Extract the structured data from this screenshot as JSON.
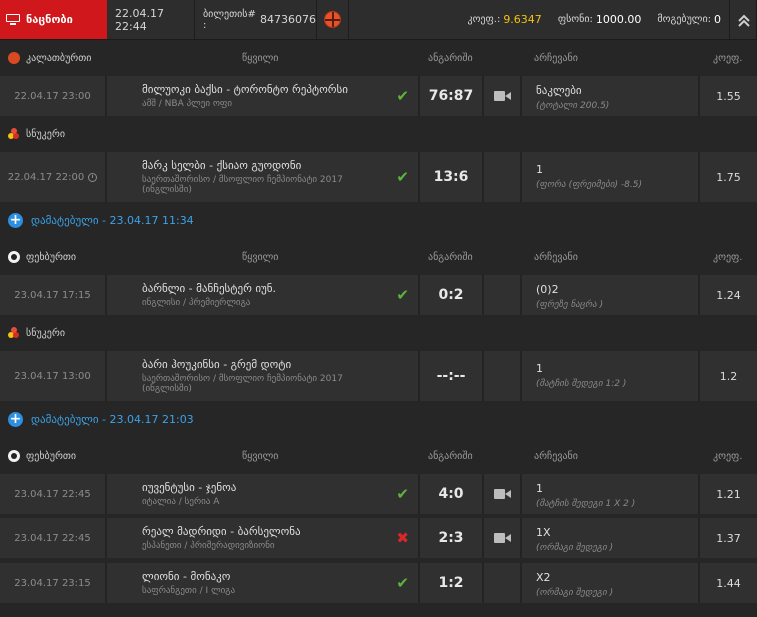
{
  "topbar": {
    "tab_label": "ნაცნობი",
    "datetime": "22.04.17 22:44",
    "ticket_label": "ბილეთის# :",
    "ticket_number": "84736076",
    "coef_label": "კოეფ.:",
    "coef_value": "9.6347",
    "amount_label": "ფსონი:",
    "amount_value": "1000.00",
    "win_label": "მოგებული:",
    "win_value": "0"
  },
  "columns": {
    "event": "წყვილი",
    "score": "ანგარიში",
    "choice": "არჩევანი",
    "coef": "კოეფ."
  },
  "sections": [
    {
      "sport": "კალათბურთი",
      "icon": "basketball-icon"
    },
    {
      "sport": "სნუკერი",
      "icon": "snooker-icon"
    },
    {
      "sport": "ფეხბურთი",
      "icon": "soccer-icon"
    },
    {
      "sport": "სნუკერი",
      "icon": "snooker-icon"
    },
    {
      "sport": "ფეხბურთი",
      "icon": "soccer-icon"
    }
  ],
  "added": [
    {
      "label": "დამატებული - 23.04.17 11:34"
    },
    {
      "label": "დამატებული - 23.04.17 21:03"
    }
  ],
  "rows": [
    {
      "date": "22.04.17 23:00",
      "name": "მილუოკი ბაქსი - ტორონტო რეპტორსი",
      "league": "ამშ / NBA პლეი ოფი",
      "result": "win",
      "score": "76:87",
      "video": true,
      "pick": "ნაკლები",
      "pick_sub": "(ტოტალი 200.5)",
      "coef": "1.55"
    },
    {
      "date": "22.04.17 22:00",
      "name": "მარკ სელბი - ქსიაო გუოდონი",
      "league": "საერთაშორისო / მსოფლიო ჩემპიონატი 2017 (ინგლისში)",
      "result": "win",
      "score": "13:6",
      "video": false,
      "pick": "1",
      "pick_sub": "(ფორა (ფრეიმები) -8.5)",
      "coef": "1.75"
    },
    {
      "date": "23.04.17 17:15",
      "name": "ბარნლი - მანჩესტერ იუნ.",
      "league": "ინგლისი / პრემიერლიგა",
      "result": "win",
      "score": "0:2",
      "video": false,
      "pick": "(0)2",
      "pick_sub": "(ფრეზე ნაცრა )",
      "coef": "1.24"
    },
    {
      "date": "23.04.17 13:00",
      "name": "ბარი ჰოუკინსი - გრემ დოტი",
      "league": "საერთაშორისო / მსოფლიო ჩემპიონატი 2017 (ინგლისში)",
      "result": "none",
      "score": "--:--",
      "video": false,
      "pick": "1",
      "pick_sub": "(მატჩის შედეგი 1:2 )",
      "coef": "1.2"
    },
    {
      "date": "23.04.17 22:45",
      "name": "იუვენტუსი - ჯენოა",
      "league": "იტალია / სერია A",
      "result": "win",
      "score": "4:0",
      "video": true,
      "pick": "1",
      "pick_sub": "(მატჩის შედეგი 1 X 2 )",
      "coef": "1.21"
    },
    {
      "date": "23.04.17 22:45",
      "name": "რეალ მადრიდი - ბარსელონა",
      "league": "ესპანეთი / პრიმერადივიზიონი",
      "result": "lose",
      "score": "2:3",
      "video": true,
      "pick": "1X",
      "pick_sub": "(ორმაგი შედეგი )",
      "coef": "1.37"
    },
    {
      "date": "23.04.17 23:15",
      "name": "ლიონი - მონაკო",
      "league": "საფრანგეთი / I ლიგა",
      "result": "win",
      "score": "1:2",
      "video": false,
      "pick": "X2",
      "pick_sub": "(ორმაგი შედეგი )",
      "coef": "1.44"
    }
  ],
  "colors": {
    "accent_red": "#d0171c",
    "win_green": "#5cb43d",
    "lose_red": "#d8282c",
    "added_blue": "#3aa3ea",
    "coef_yellow": "#f4c20d"
  }
}
